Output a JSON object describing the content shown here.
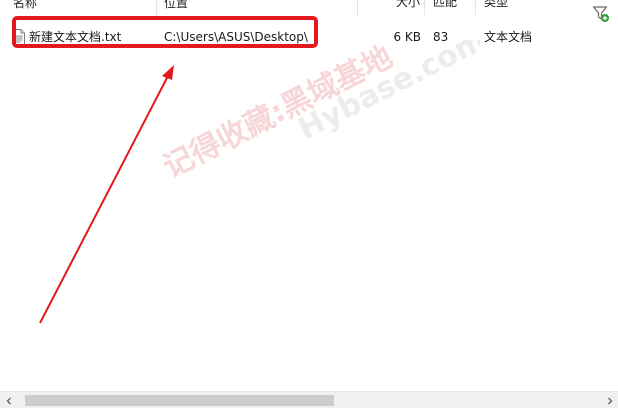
{
  "columns": {
    "name": "名称",
    "path": "位置",
    "size": "大小",
    "match": "匹配",
    "type": "类型"
  },
  "results": [
    {
      "name": "新建文本文档.txt",
      "path": "C:\\Users\\ASUS\\Desktop\\",
      "size": "6 KB",
      "match": "83",
      "type": "文本文档",
      "icon": "text-file-icon"
    }
  ],
  "watermark": {
    "text_cn": "记得收藏:黑域基地",
    "text_en": "Hybase.com"
  },
  "colors": {
    "annotation_red": "#e3191f",
    "watermark_red": "#f3c9c9",
    "watermark_grey": "#e8e8e8",
    "scrollbar_track": "#f0f0f0",
    "scrollbar_thumb": "#cdcdcd",
    "filter_icon_green": "#2e9b3e"
  },
  "icons": {
    "filter": "filter-add-icon",
    "scroll_left": "chevron-left-icon",
    "scroll_right": "chevron-right-icon"
  }
}
